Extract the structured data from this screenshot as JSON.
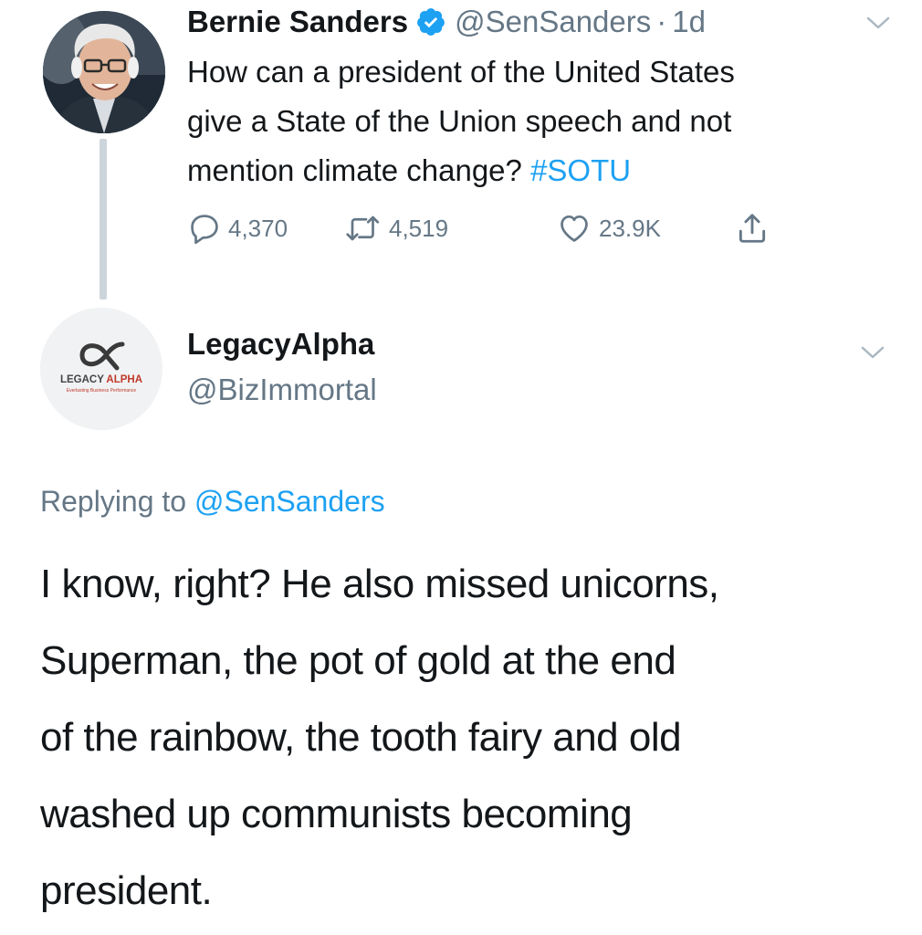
{
  "tweet": {
    "author_name": "Bernie Sanders",
    "author_handle": "@SenSanders",
    "separator": "·",
    "time": "1d",
    "text_lines": [
      "How can a president of the United States",
      "give a State of the Union speech and not",
      "mention climate change? "
    ],
    "hashtag": "#SOTU",
    "counts": {
      "replies": "4,370",
      "retweets": "4,519",
      "likes": "23.9K"
    }
  },
  "reply": {
    "author_name": "LegacyAlpha",
    "author_handle": "@BizImmortal",
    "avatar_logo_text": "LEGACY ALPHA",
    "avatar_logo_tagline": "Everlasting Business Performance",
    "replying_prefix": "Replying to ",
    "replying_to": "@SenSanders",
    "text_lines": [
      "I know, right? He also missed unicorns,",
      "Superman, the pot of gold at the end",
      "of the rainbow, the tooth fairy and old",
      "washed up communists becoming",
      "president."
    ]
  },
  "icons": {
    "verified": "verified-badge-icon",
    "reply": "reply-icon",
    "retweet": "retweet-icon",
    "like": "heart-icon",
    "share": "share-icon",
    "menu": "chevron-down-icon"
  },
  "colors": {
    "link": "#1da1f2",
    "secondary_text": "#657786",
    "primary_text": "#14171a",
    "thread_line": "#cdd5dc"
  }
}
